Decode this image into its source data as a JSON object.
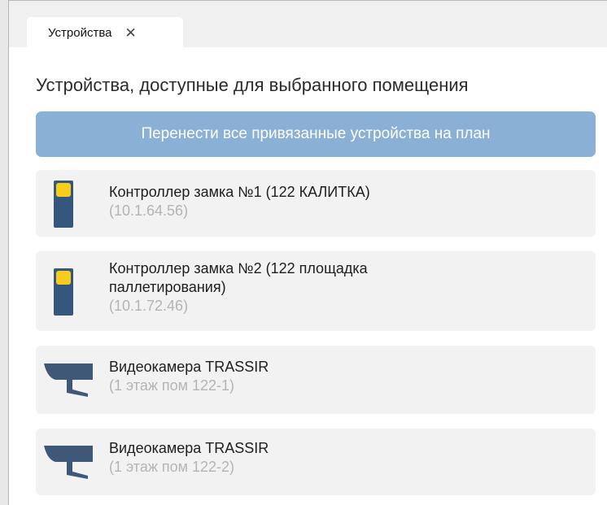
{
  "tab": {
    "label": "Устройства",
    "close_glyph": "✕"
  },
  "heading": "Устройства, доступные для выбранного помещения",
  "move_button": "Перенести все привязанные устройства на план",
  "devices": [
    {
      "icon": "lock-controller-icon",
      "name": "Контроллер замка №1 (122 КАЛИТКА)",
      "sub": "(10.1.64.56)"
    },
    {
      "icon": "lock-controller-icon",
      "name": "Контроллер замка №2 (122 площадка паллетирования)",
      "sub": "(10.1.72.46)"
    },
    {
      "icon": "video-camera-icon",
      "name": "Видеокамера TRASSIR",
      "sub": "(1 этаж пом 122-1)"
    },
    {
      "icon": "video-camera-icon",
      "name": "Видеокамера TRASSIR",
      "sub": "(1 этаж пом 122-2)"
    }
  ],
  "colors": {
    "accent_button": "#8ab0d6",
    "controller_body": "#35577e",
    "controller_led": "#f8cc1b",
    "camera": "#3f5877",
    "card_bg": "#f2f2f2",
    "subtext": "#b4b4b4"
  }
}
